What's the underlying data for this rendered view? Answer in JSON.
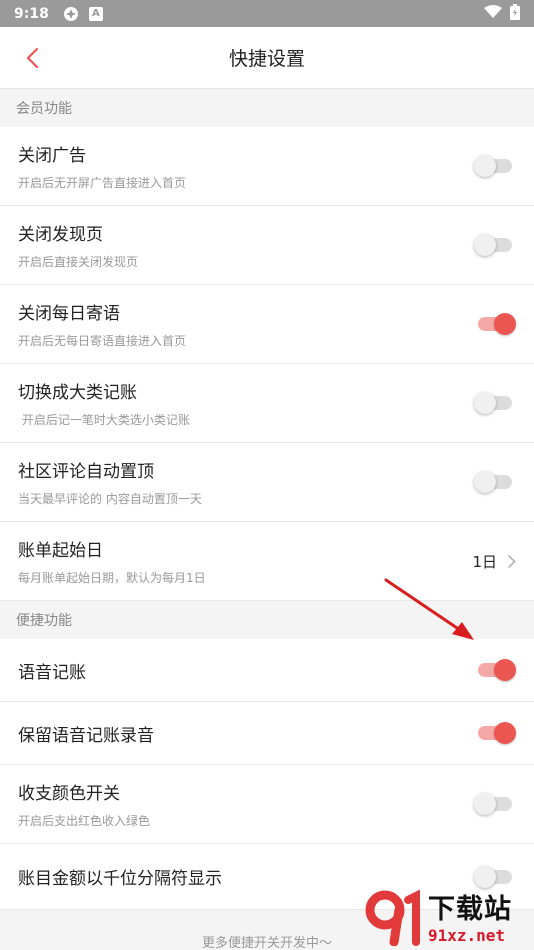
{
  "status_bar": {
    "time": "9:18",
    "a_badge": "A"
  },
  "header": {
    "title": "快捷设置"
  },
  "sections": [
    {
      "label": "会员功能"
    },
    {
      "label": "便捷功能"
    }
  ],
  "rows": [
    {
      "title": "关闭广告",
      "subtitle": "开启后无开屏广告直接进入首页",
      "on": false
    },
    {
      "title": "关闭发现页",
      "subtitle": "开启后直接关闭发现页",
      "on": false
    },
    {
      "title": "关闭每日寄语",
      "subtitle": "开启后无每日寄语直接进入首页",
      "on": true
    },
    {
      "title": "切换成大类记账",
      "subtitle": " 开启后记一笔时大类选小类记账",
      "on": false
    },
    {
      "title": "社区评论自动置顶",
      "subtitle": "当天最早评论的 内容自动置顶一天",
      "on": false
    },
    {
      "title": "账单起始日",
      "subtitle": "每月账单起始日期，默认为每月1日",
      "value": "1日"
    },
    {
      "title": "语音记账",
      "on": true
    },
    {
      "title": "保留语音记账录音",
      "on": true
    },
    {
      "title": "收支颜色开关",
      "subtitle": "开启后支出红色收入绿色",
      "on": false
    },
    {
      "title": "账目金额以千位分隔符显示",
      "on": false
    }
  ],
  "footer": {
    "note": "更多便捷开关开发中～"
  },
  "watermark": {
    "text": "下载站",
    "url": "91xz.net"
  },
  "colors": {
    "accent": "#ec5650",
    "annotation_arrow": "#d81e1e"
  }
}
